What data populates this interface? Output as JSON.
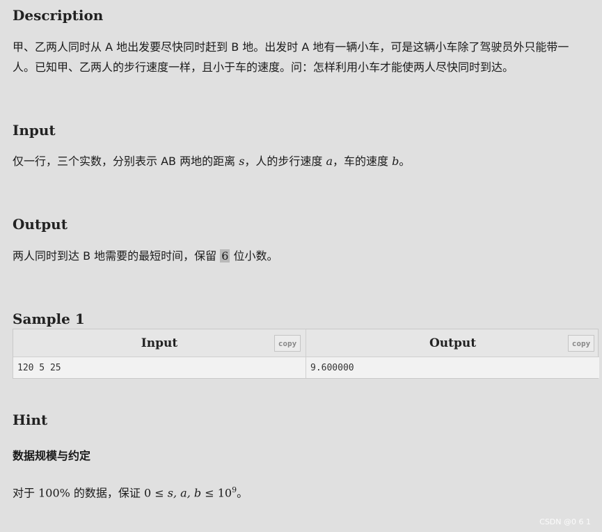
{
  "description": {
    "heading": "Description",
    "line1": "甲、乙两人同时从 A 地出发要尽快同时赶到 B 地。出发时 A 地有一辆小车，可是这辆小车除了驾驶员外只能带一",
    "line2": "人。已知甲、乙两人的步行速度一样，且小于车的速度。问：怎样利用小车才能使两人尽快同时到达。"
  },
  "input": {
    "heading": "Input",
    "text_a": "仅一行，三个实数，分别表示 AB 两地的距离 ",
    "var_s": "s",
    "text_b": "，人的步行速度 ",
    "var_a": "a",
    "text_c": "，车的速度 ",
    "var_b": "b",
    "text_d": "。"
  },
  "output": {
    "heading": "Output",
    "text_a": "两人同时到达 B 地需要的最短时间，保留 ",
    "digits": "6",
    "text_b": " 位小数。"
  },
  "sample": {
    "heading": "Sample 1",
    "input_header": "Input",
    "output_header": "Output",
    "copy_label": "copy",
    "input_value": "120 5 25",
    "output_value": "9.600000"
  },
  "hint": {
    "heading": "Hint",
    "subheading": "数据规模与约定",
    "text_a": "对于 ",
    "percent": "100%",
    "text_b": " 的数据，保证 ",
    "zero": "0",
    "le1": " ≤ ",
    "vars": "s, a, b",
    "le2": " ≤ ",
    "base": "10",
    "exp": "9",
    "text_c": "。"
  },
  "watermark": "CSDN @0 6 1"
}
